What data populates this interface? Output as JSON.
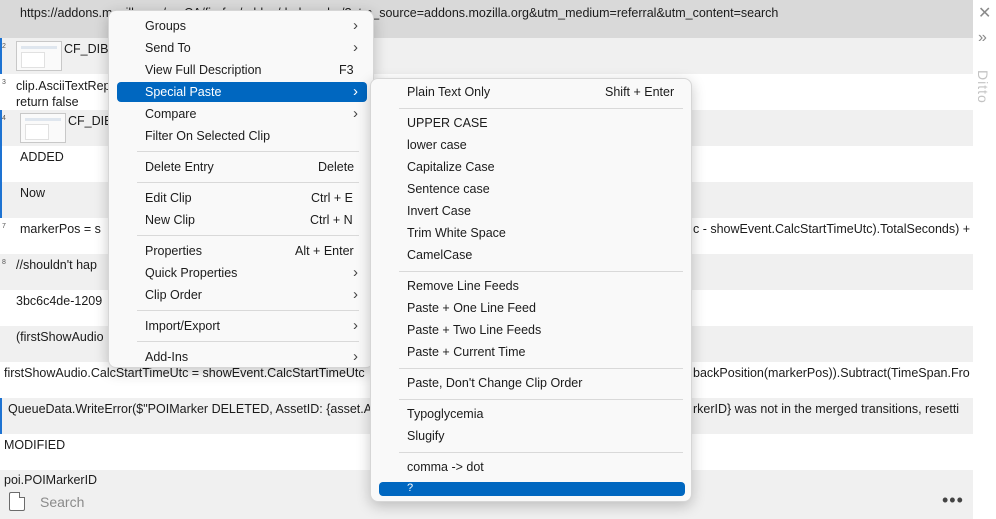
{
  "url_row": {
    "text": "https://addons.mozilla.org/en-CA/firefox/addon/darkreader/?utm_source=addons.mozilla.org&utm_medium=referral&utm_content=search"
  },
  "rows": [
    {
      "num": "2",
      "text": "CF_DIB"
    },
    {
      "num": "3",
      "text": "clip.AsciiTextRep\nreturn false"
    },
    {
      "num": "4",
      "text": "CF_DIB"
    },
    {
      "num": "",
      "text": "ADDED"
    },
    {
      "num": "",
      "text": "Now"
    },
    {
      "num": "7",
      "text": "markerPos = s"
    },
    {
      "num": "8",
      "text": "//shouldn't hap"
    },
    {
      "num": "",
      "text": "3bc6c4de-1209"
    },
    {
      "num": "",
      "text": "(firstShowAudio"
    },
    {
      "num": "",
      "text": "firstShowAudio.CalcStartTimeUtc = showEvent.CalcStartTimeUtc"
    },
    {
      "num": "",
      "text": "QueueData.WriteError($\"POIMarker DELETED, AssetID: {asset.A"
    },
    {
      "num": "",
      "text": "MODIFIED"
    },
    {
      "num": "",
      "text": "poi.POIMarkerID"
    }
  ],
  "row_tails": {
    "markerpos": "c - showEvent.CalcStartTimeUtc).TotalSeconds) +",
    "firstshow": "backPosition(markerPos)).Subtract(TimeSpan.Fro",
    "queuedata": "rkerID} was not in the merged transitions, resetti"
  },
  "sidebar": {
    "close": "✕",
    "expand": "»",
    "brand": "Ditto"
  },
  "bottom": {
    "search_placeholder": "Search",
    "more": "•••"
  },
  "context_menu": [
    {
      "label": "Groups",
      "shortcut": "",
      "submenu": true
    },
    {
      "label": "Send To",
      "shortcut": "",
      "submenu": true
    },
    {
      "label": "View Full Description",
      "shortcut": "F3",
      "submenu": false
    },
    {
      "label": "Special Paste",
      "shortcut": "",
      "submenu": true
    },
    {
      "label": "Compare",
      "shortcut": "",
      "submenu": true
    },
    {
      "label": "Filter On Selected Clip",
      "shortcut": "",
      "submenu": false
    },
    {
      "label": "Delete Entry",
      "shortcut": "Delete",
      "submenu": false
    },
    {
      "label": "Edit Clip",
      "shortcut": "Ctrl + E",
      "submenu": false
    },
    {
      "label": "New Clip",
      "shortcut": "Ctrl + N",
      "submenu": false
    },
    {
      "label": "Properties",
      "shortcut": "Alt + Enter",
      "submenu": false
    },
    {
      "label": "Quick Properties",
      "shortcut": "",
      "submenu": true
    },
    {
      "label": "Clip Order",
      "shortcut": "",
      "submenu": true
    },
    {
      "label": "Import/Export",
      "shortcut": "",
      "submenu": true
    },
    {
      "label": "Add-Ins",
      "shortcut": "",
      "submenu": true
    }
  ],
  "special_paste_menu": [
    {
      "label": "Plain Text Only",
      "shortcut": "Shift + Enter"
    },
    {
      "label": "UPPER CASE",
      "shortcut": ""
    },
    {
      "label": "lower case",
      "shortcut": ""
    },
    {
      "label": "Capitalize Case",
      "shortcut": ""
    },
    {
      "label": "Sentence case",
      "shortcut": ""
    },
    {
      "label": "Invert Case",
      "shortcut": ""
    },
    {
      "label": "Trim White Space",
      "shortcut": ""
    },
    {
      "label": "CamelCase",
      "shortcut": ""
    },
    {
      "label": "Remove Line Feeds",
      "shortcut": ""
    },
    {
      "label": "Paste + One Line Feed",
      "shortcut": ""
    },
    {
      "label": "Paste + Two Line Feeds",
      "shortcut": ""
    },
    {
      "label": "Paste + Current Time",
      "shortcut": ""
    },
    {
      "label": "Paste, Don't Change Clip Order",
      "shortcut": ""
    },
    {
      "label": "Typoglycemia",
      "shortcut": ""
    },
    {
      "label": "Slugify",
      "shortcut": ""
    },
    {
      "label": "comma -> dot",
      "shortcut": ""
    },
    {
      "label": "?",
      "shortcut": ""
    }
  ],
  "colors": {
    "highlight": "#0067c0",
    "accent": "#1e73d2"
  },
  "icons": {
    "submenu_arrow": "›"
  }
}
